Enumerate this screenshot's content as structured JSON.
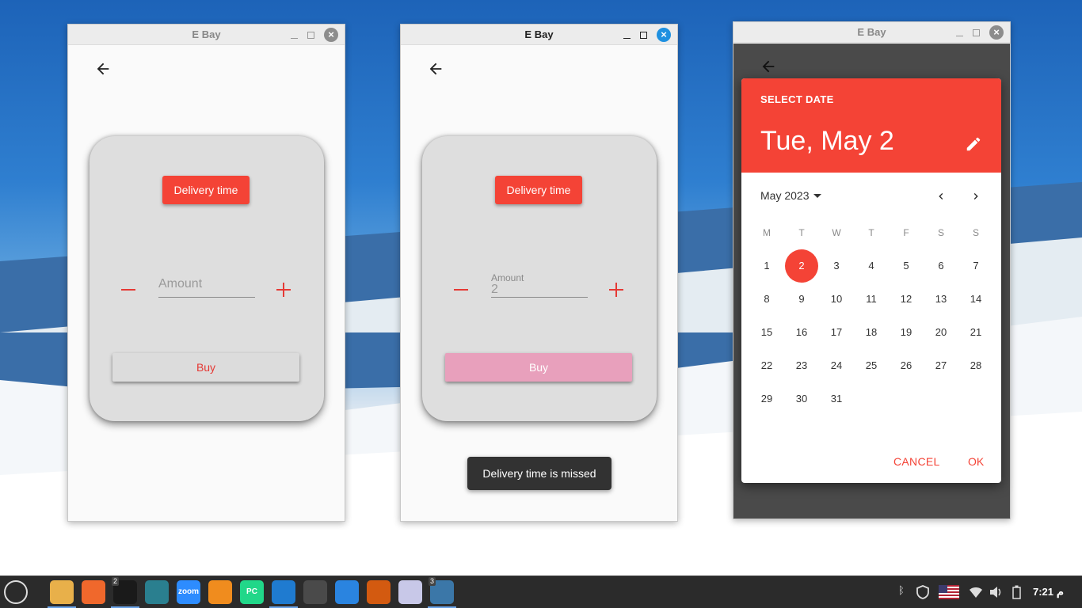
{
  "windows": [
    {
      "title": "E Bay",
      "active": false,
      "delivery_label": "Delivery time",
      "amount_placeholder": "Amount",
      "buy_label": "Buy"
    },
    {
      "title": "E Bay",
      "active": true,
      "delivery_label": "Delivery time",
      "amount_label": "Amount",
      "amount_value": "2",
      "buy_label": "Buy",
      "toast": "Delivery time is missed"
    },
    {
      "title": "E Bay",
      "active": false,
      "date_picker": {
        "heading": "SELECT DATE",
        "selected_date": "Tue, May 2",
        "month_label": "May 2023",
        "weekdays": [
          "M",
          "T",
          "W",
          "T",
          "F",
          "S",
          "S"
        ],
        "days": [
          "1",
          "2",
          "3",
          "4",
          "5",
          "6",
          "7",
          "8",
          "9",
          "10",
          "11",
          "12",
          "13",
          "14",
          "15",
          "16",
          "17",
          "18",
          "19",
          "20",
          "21",
          "22",
          "23",
          "24",
          "25",
          "26",
          "27",
          "28",
          "29",
          "30",
          "31"
        ],
        "selected_day": "2",
        "cancel_label": "CANCEL",
        "ok_label": "OK"
      }
    }
  ],
  "taskbar": {
    "apps": [
      {
        "name": "menu-icon"
      },
      {
        "name": "files-icon",
        "indicator": true
      },
      {
        "name": "firefox-icon"
      },
      {
        "name": "terminal-icon",
        "badge": "2",
        "indicator": true
      },
      {
        "name": "software-manager-icon"
      },
      {
        "name": "zoom-icon",
        "label": "zoom"
      },
      {
        "name": "drawing-icon"
      },
      {
        "name": "pycharm-icon",
        "label": "PC"
      },
      {
        "name": "vscode-icon",
        "indicator": true
      },
      {
        "name": "sublime-icon"
      },
      {
        "name": "remote-icon"
      },
      {
        "name": "virtualbox-icon"
      },
      {
        "name": "text-editor-icon"
      },
      {
        "name": "python-icon",
        "badge": "3",
        "indicator": true
      }
    ],
    "clock": "7:21 م"
  },
  "colors": {
    "accent": "#f44336",
    "pink_button": "#e8a0bc",
    "active_close": "#1e90e0"
  }
}
